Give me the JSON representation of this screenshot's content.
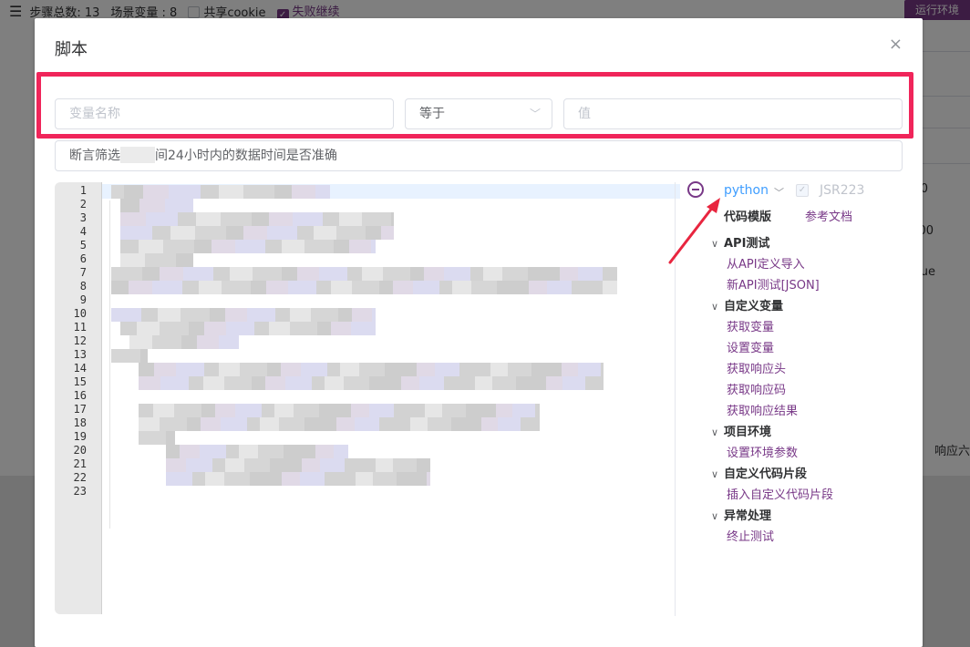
{
  "background": {
    "toolbar": {
      "step_total": "步骤总数: 13",
      "scenario_vars": "场景变量 : 8",
      "share_cookie": "共享cookie",
      "fail_continue": "失败继续",
      "run_env_button": "运行环境"
    },
    "right_fragments": [
      "0",
      "00",
      "ue",
      "响应六"
    ]
  },
  "dialog": {
    "title": "脚本",
    "close_glyph": "×",
    "condition": {
      "var_name_placeholder": "变量名称",
      "operator_value": "等于",
      "value_placeholder": "值"
    },
    "description": {
      "prefix": "断言筛选",
      "suffix": "间24小时内的数据时间是否准确"
    },
    "editor": {
      "line_numbers": [
        "1",
        "2",
        "3",
        "4",
        "5",
        "6",
        "7",
        "8",
        "9",
        "10",
        "11",
        "12",
        "13",
        "14",
        "15",
        "16",
        "17",
        "18",
        "19",
        "20",
        "21",
        "22",
        "23"
      ]
    },
    "right_panel": {
      "language": "python",
      "jsr_label": "JSR223",
      "templates_label": "代码模版",
      "docs_label": "参考文档",
      "groups": [
        {
          "label": "API测试",
          "items": [
            "从API定义导入",
            "新API测试[JSON]"
          ]
        },
        {
          "label": "自定义变量",
          "items": [
            "获取变量",
            "设置变量",
            "获取响应头",
            "获取响应码",
            "获取响应结果"
          ]
        },
        {
          "label": "项目环境",
          "items": [
            "设置环境参数"
          ]
        },
        {
          "label": "自定义代码片段",
          "items": [
            "插入自定义代码片段"
          ]
        },
        {
          "label": "异常处理",
          "items": [
            "终止测试"
          ]
        }
      ]
    }
  },
  "colors": {
    "accent": "#783887",
    "link_blue": "#409eff",
    "highlight_red": "#f0255a",
    "arrow_red": "#e8253f"
  }
}
